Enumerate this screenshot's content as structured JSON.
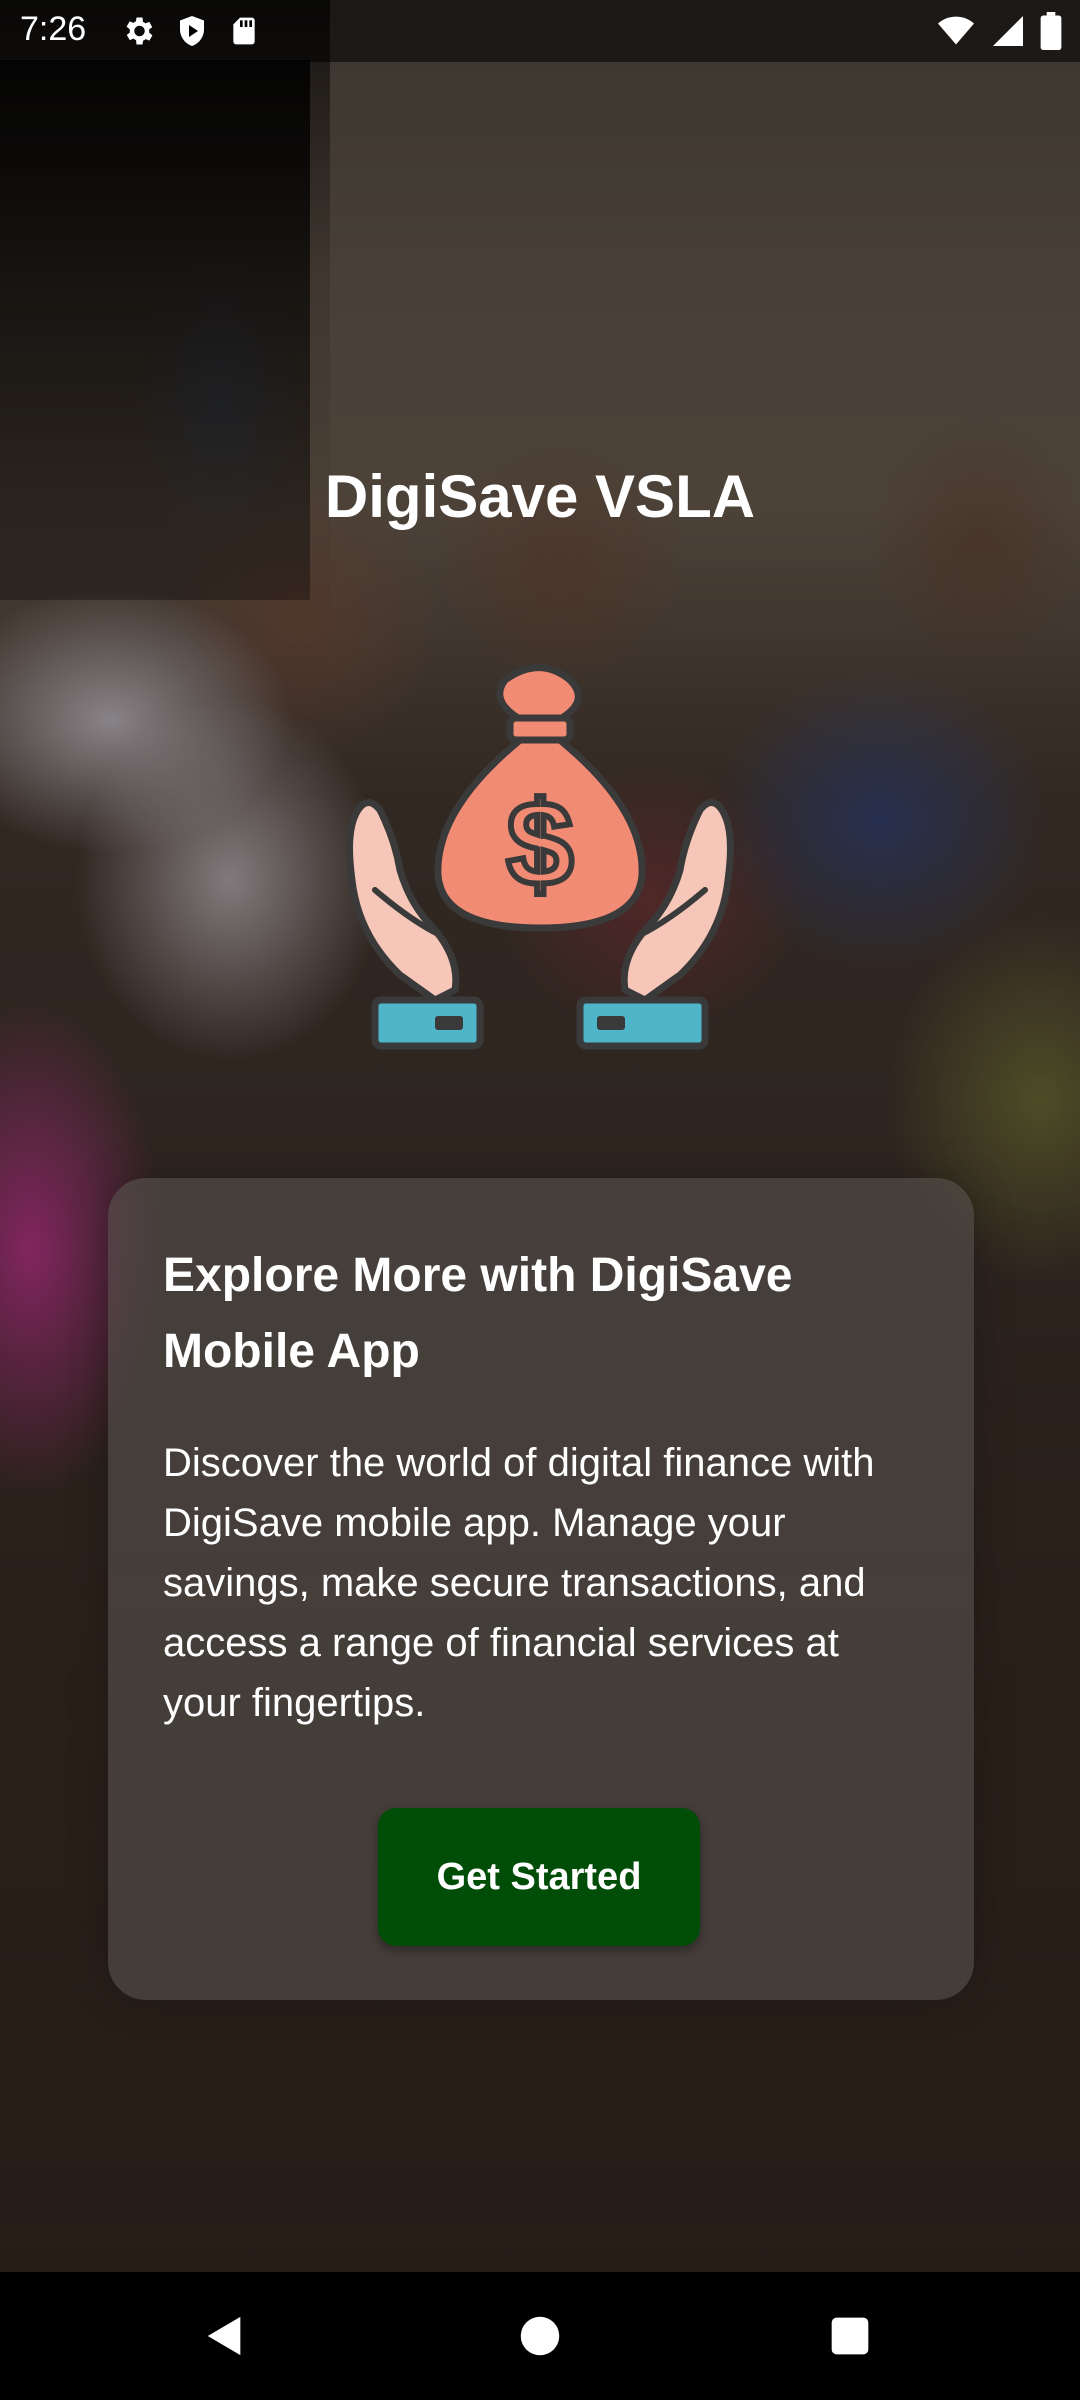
{
  "status_bar": {
    "time": "7:26",
    "left_icons": [
      "settings-icon",
      "shield-play-icon",
      "sd-card-icon"
    ],
    "right_icons": [
      "wifi-icon",
      "signal-icon",
      "battery-icon"
    ]
  },
  "app": {
    "title": "DigiSave VSLA",
    "illustration": "money-bag-hands-icon"
  },
  "card": {
    "title": "Explore More with DigiSave Mobile App",
    "body": "Discover the world of digital finance with DigiSave mobile app. Manage your savings, make secure transactions, and access a range of financial services at your fingertips.",
    "button_label": "Get Started"
  },
  "colors": {
    "button": "#004d07",
    "bag": "#f28b74",
    "hands": "#f6c7b8",
    "cuffs": "#4fb6c9",
    "outline": "#3a3a3a"
  },
  "nav_bar": {
    "buttons": [
      "back-icon",
      "home-icon",
      "recents-icon"
    ]
  }
}
